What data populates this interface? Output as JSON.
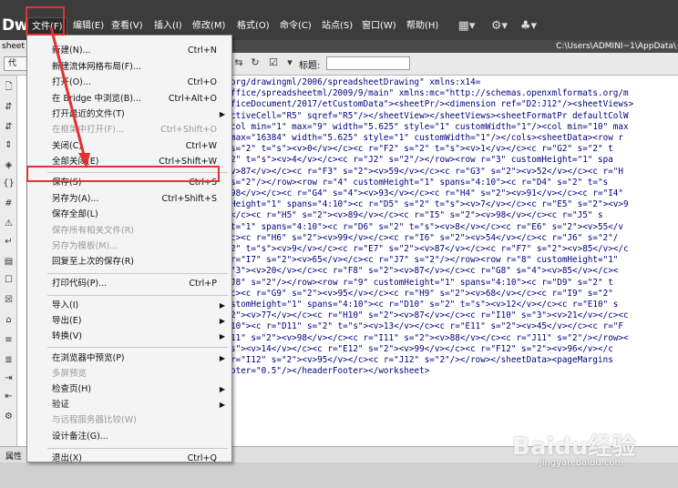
{
  "app": {
    "logo": "Dw"
  },
  "menubar": {
    "items": [
      "文件(F)",
      "编辑(E)",
      "查看(V)",
      "插入(I)",
      "修改(M)",
      "格式(O)",
      "命令(C)",
      "站点(S)",
      "窗口(W)",
      "帮助(H)"
    ]
  },
  "toolbar_icons": [
    "layout-icon",
    "gear-icon",
    "sitemap-icon"
  ],
  "document": {
    "tab_label": "sheet",
    "path": "C:\\Users\\ADMINI~1\\AppData\\",
    "code_button": "代",
    "title_label": "标题:",
    "title_value": ""
  },
  "code": {
    "lines": [
      "org/drawingml/2006/spreadsheetDrawing\" xmlns:x14=",
      "ffice/spreadsheetml/2009/9/main\" xmlns:mc=\"http://schemas.openxmlformats.org/m",
      "ficeDocument/2017/etCustomData\"><sheetPr/><dimension ref=\"D2:J12\"/><sheetViews>",
      "ctiveCell=\"R5\" sqref=\"R5\"/></sheetView></sheetViews><sheetFormatPr defaultColW",
      "col min=\"1\" max=\"9\" width=\"5.625\" style=\"1\" customWidth=\"1\"/><col min=\"10\" max",
      "max=\"16384\" width=\"5.625\" style=\"1\" customWidth=\"1\"/></cols><sheetData><row r",
      "s=\"2\" t=\"s\"><v>0</v></c><c r=\"F2\" s=\"2\" t=\"s\"><v>1</v></c><c r=\"G2\" s=\"2\" t",
      "2\" t=\"s\"><v>4</v></c><c r=\"J2\" s=\"2\"/></row><row r=\"3\" customHeight=\"1\" spa",
      "v>87</v></c><c r=\"F3\" s=\"2\"><v>59</v></c><c r=\"G3\" s=\"2\"><v>52</v></c><c r=\"H",
      "s=\"2\"/></row><row r=\"4\" customHeight=\"1\" spans=\"4:10\"><c r=\"D4\" s=\"2\" t=\"s",
      "98</v></c><c r=\"G4\" s=\"4\"><v>93</v></c><c r=\"H4\" s=\"2\"><v>91</v></c><c r=\"I4\"",
      "Height=\"1\" spans=\"4:10\"><c r=\"D5\" s=\"2\" t=\"s\"><v>7</v></c><c r=\"E5\" s=\"2\"><v>9",
      "</c><c r=\"H5\" s=\"2\"><v>89</v></c><c r=\"I5\" s=\"2\"><v>98</v></c><c r=\"J5\" s",
      "t=\"1\" spans=\"4:10\"><c r=\"D6\" s=\"2\" t=\"s\"><v>8</v></c><c r=\"E6\" s=\"2\"><v>55</v",
      "c><c r=\"H6\" s=\"2\"><v>99</v></c><c r=\"I6\" s=\"2\"><v>54</v></c><c r=\"J6\" s=\"2\"/",
      "2\" t=\"s\"><v>9</v></c><c r=\"E7\" s=\"2\"><v>87</v></c><c r=\"F7\" s=\"2\"><v>85</v></c",
      "r=\"I7\" s=\"2\"><v>65</v></c><c r=\"J7\" s=\"2\"/></row><row r=\"8\" customHeight=\"1\"",
      "\"3\"><v>20</v></c><c r=\"F8\" s=\"2\"><v>87</v></c><c r=\"G8\" s=\"4\"><v>85</v></c><",
      "J8\" s=\"2\"/></row><row r=\"9\" customHeight=\"1\" spans=\"4:10\"><c r=\"D9\" s=\"2\" t",
      "c><c r=\"G9\" s=\"2\"><v>95</v></c><c r=\"H9\" s=\"2\"><v>68</v></c><c r=\"I9\" s=\"2\"",
      "stomHeight=\"1\" spans=\"4:10\"><c r=\"D10\" s=\"2\" t=\"s\"><v>12</v></c><c r=\"E10\" s",
      "2\"><v>77</v></c><c r=\"H10\" s=\"2\"><v>87</v></c><c r=\"I10\" s=\"3\"><v>21</v></c><c",
      "10\"><c r=\"D11\" s=\"2\" t=\"s\"><v>13</v></c><c r=\"E11\" s=\"2\"><v>45</v></c><c r=\"F",
      "11\" s=\"2\"><v>98</v></c><c r=\"I11\" s=\"2\"><v>88</v></c><c r=\"J11\" s=\"2\"/></row><",
      "s\"><v>14</v></c><c r=\"E12\" s=\"2\"><v>99</v></c><c r=\"F12\" s=\"2\"><v>96</v></c",
      "r=\"I12\" s=\"2\"><v>95</v></c><c r=\"J12\" s=\"2\"/></row></sheetData><pageMargins",
      "oter=\"0.5\"/></headerFooter></worksheet>"
    ]
  },
  "file_menu": {
    "items": [
      {
        "label": "新建(N)...",
        "shortcut": "Ctrl+N"
      },
      {
        "label": "新建流体网格布局(F)..."
      },
      {
        "label": "打开(O)...",
        "shortcut": "Ctrl+O"
      },
      {
        "label": "在 Bridge 中浏览(B)...",
        "shortcut": "Ctrl+Alt+O"
      },
      {
        "label": "打开最近的文件(T)",
        "submenu": true
      },
      {
        "label": "在框架中打开(F)...",
        "shortcut": "Ctrl+Shift+O",
        "disabled": true
      },
      {
        "label": "关闭(C)",
        "shortcut": "Ctrl+W"
      },
      {
        "label": "全部关闭(E)",
        "shortcut": "Ctrl+Shift+W"
      },
      {
        "label": "保存(S)",
        "shortcut": "Ctrl+S"
      },
      {
        "label": "另存为(A)...",
        "shortcut": "Ctrl+Shift+S"
      },
      {
        "label": "保存全部(L)"
      },
      {
        "label": "保存所有相关文件(R)",
        "disabled": true
      },
      {
        "label": "另存为模板(M)...",
        "disabled": true
      },
      {
        "label": "回复至上次的保存(R)"
      },
      {
        "label": "打印代码(P)...",
        "shortcut": "Ctrl+P"
      },
      {
        "label": "导入(I)",
        "submenu": true
      },
      {
        "label": "导出(E)",
        "submenu": true
      },
      {
        "label": "转换(V)",
        "submenu": true
      },
      {
        "label": "在浏览器中预览(P)",
        "submenu": true
      },
      {
        "label": "多屏预览",
        "disabled": true
      },
      {
        "label": "检查页(H)",
        "submenu": true
      },
      {
        "label": "验证",
        "submenu": true
      },
      {
        "label": "与远程服务器比较(W)",
        "disabled": true
      },
      {
        "label": "设计备注(G)..."
      },
      {
        "label": "退出(X)",
        "shortcut": "Ctrl+Q"
      }
    ]
  },
  "status": {
    "properties_label": "属性"
  },
  "watermark": {
    "brand": "Baidu经验",
    "url": "jingyan.baidu.com"
  },
  "annotation_color": "#e23232"
}
